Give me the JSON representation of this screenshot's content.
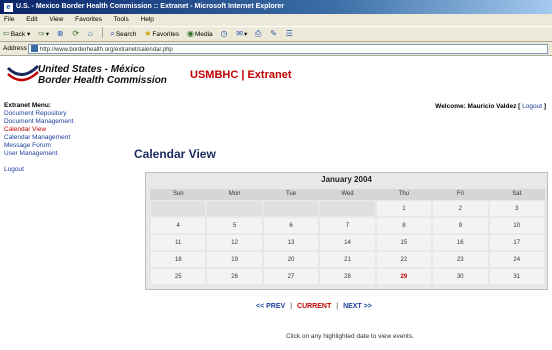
{
  "window": {
    "title": "U.S. - Mexico Border Health Commission :: Extranet - Microsoft Internet Explorer"
  },
  "menu": [
    "File",
    "Edit",
    "View",
    "Favorites",
    "Tools",
    "Help"
  ],
  "toolbar": {
    "back": "Back",
    "search": "Search",
    "favorites": "Favorites",
    "media": "Media"
  },
  "address": {
    "label": "Address",
    "url": "http://www.borderhealth.org/extranet/calendar.php"
  },
  "header": {
    "org_line1": "United States - México",
    "org_line2": "Border Health Commission",
    "extranet": "USMBHC | Extranet"
  },
  "nav": {
    "heading": "Extranet Menu:",
    "items": [
      "Document Repository",
      "Document Management",
      "Calendar View",
      "Calendar Management",
      "Message Forum",
      "User Management"
    ],
    "logout": "Logout"
  },
  "welcome": {
    "text": "Welcome: Mauricio Valdez [",
    "link": "Logout",
    "close": "]"
  },
  "page": {
    "title": "Calendar View"
  },
  "calendar": {
    "month": "January 2004",
    "days": [
      "Sun",
      "Mon",
      "Tue",
      "Wed",
      "Thu",
      "Fri",
      "Sat"
    ],
    "weeks": [
      [
        "",
        "",
        "",
        "",
        "1",
        "2",
        "3"
      ],
      [
        "4",
        "5",
        "6",
        "7",
        "8",
        "9",
        "10"
      ],
      [
        "11",
        "12",
        "13",
        "14",
        "15",
        "16",
        "17"
      ],
      [
        "18",
        "19",
        "20",
        "21",
        "22",
        "23",
        "24"
      ],
      [
        "25",
        "26",
        "27",
        "28",
        "29",
        "30",
        "31"
      ]
    ],
    "highlighted": [
      "29"
    ],
    "prev": "<< PREV",
    "current": "CURRENT",
    "next": "NEXT >>",
    "hint": "Click on any highlighted date to view events."
  },
  "colors": {
    "accent_red": "#c00000",
    "link_blue": "#1b3f9c",
    "title_navy": "#1a2a5e"
  }
}
